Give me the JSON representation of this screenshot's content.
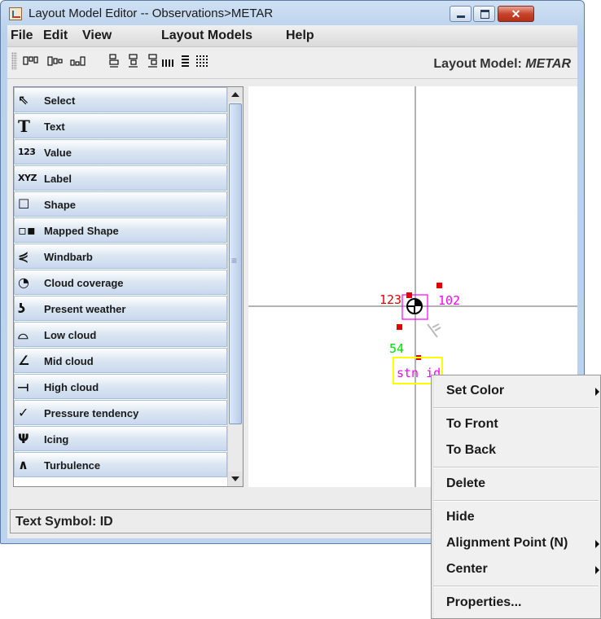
{
  "window": {
    "title": "Layout Model Editor -- Observations>METAR",
    "close_glyph": "✕"
  },
  "menubar": {
    "items": [
      "File",
      "Edit",
      "View",
      "Layout Models",
      "Help"
    ]
  },
  "toolbar": {
    "layout_model_label": "Layout Model:",
    "layout_model_value": "METAR",
    "icons": [
      "align-top-icon",
      "align-middle-icon",
      "align-bottom-icon",
      "align-left-icon",
      "align-center-icon",
      "align-right-icon",
      "distribute-horizontal-icon",
      "distribute-vertical-icon",
      "grid-icon"
    ]
  },
  "palette": {
    "items": [
      {
        "label": "Select",
        "icon": "⇖"
      },
      {
        "label": "Text",
        "icon": "T"
      },
      {
        "label": "Value",
        "icon": "123"
      },
      {
        "label": "Label",
        "icon": "XYZ"
      },
      {
        "label": "Shape",
        "icon": "☐"
      },
      {
        "label": "Mapped Shape",
        "icon": "▫▪"
      },
      {
        "label": "Windbarb",
        "icon": "⋞"
      },
      {
        "label": "Cloud coverage",
        "icon": "◔"
      },
      {
        "label": "Present weather",
        "icon": "ʖ"
      },
      {
        "label": "Low cloud",
        "icon": "⌓"
      },
      {
        "label": "Mid cloud",
        "icon": "∠"
      },
      {
        "label": "High cloud",
        "icon": "⟞"
      },
      {
        "label": "Pressure tendency",
        "icon": "✓"
      },
      {
        "label": "Icing",
        "icon": "Ψ"
      },
      {
        "label": "Turbulence",
        "icon": "∧"
      }
    ]
  },
  "canvas": {
    "value_123": "123",
    "value_102": "102",
    "value_54": "54",
    "station_id": "stn id"
  },
  "status": {
    "text": "Text Symbol: ID"
  },
  "context_menu": {
    "items": [
      {
        "label": "Set Color",
        "submenu": true
      },
      {
        "label": "To Front",
        "submenu": false
      },
      {
        "label": "To Back",
        "submenu": false
      },
      {
        "label": "Delete",
        "submenu": false
      },
      {
        "label": "Hide",
        "submenu": false
      },
      {
        "label": "Alignment Point (N)",
        "submenu": true
      },
      {
        "label": "Center",
        "submenu": true
      },
      {
        "label": "Properties...",
        "submenu": false
      }
    ]
  },
  "colors": {
    "red_marker": "#e30000",
    "magenta": "#ff00ff",
    "green": "#00dd00",
    "yellow_box": "#ffff00"
  }
}
